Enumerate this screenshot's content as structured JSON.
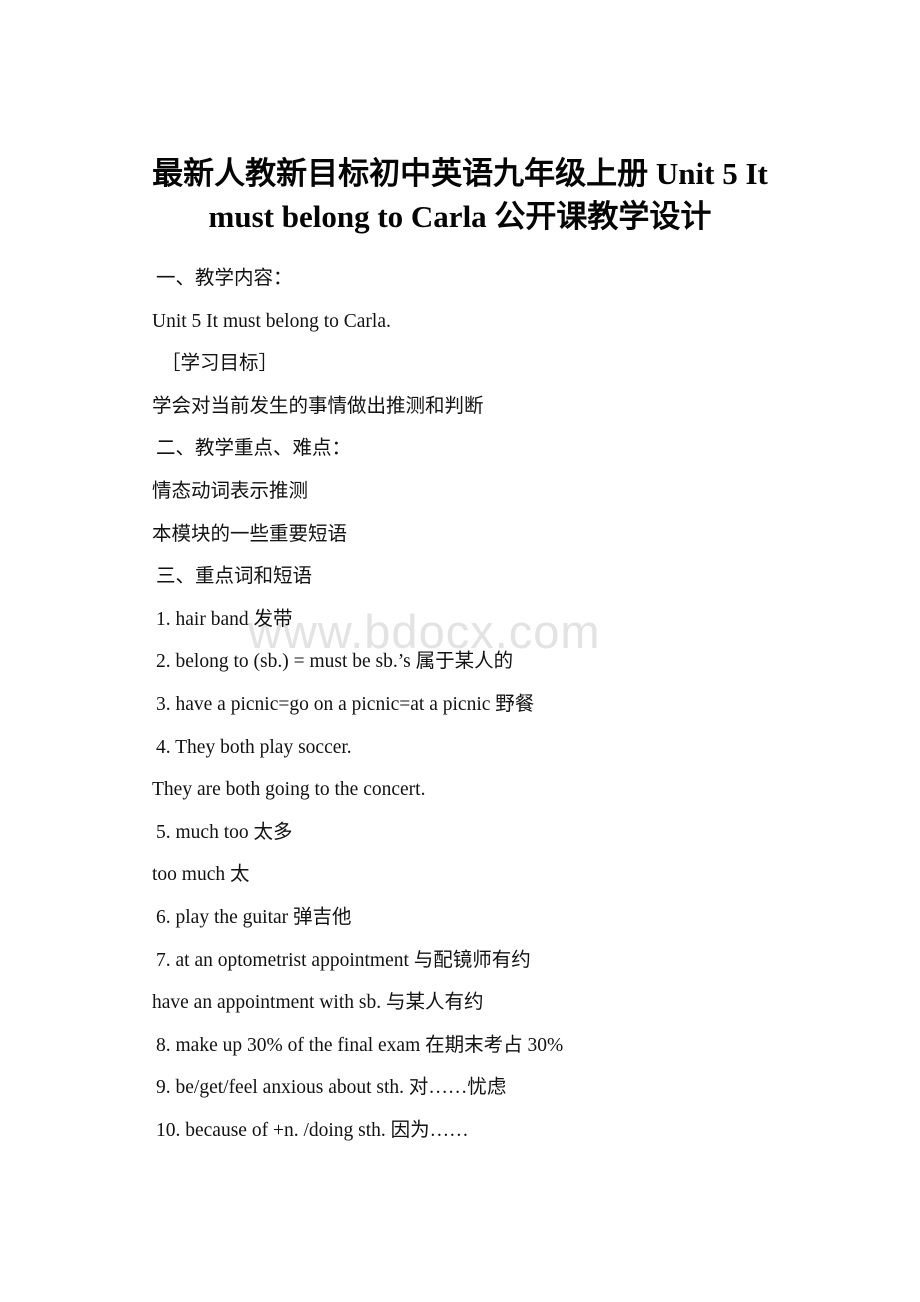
{
  "document": {
    "title_lines": [
      "最新人教新目标初中英语九年级上册 Unit 5 It",
      "must belong to Carla 公开课教学设计"
    ],
    "watermark": "www.bdocx.com",
    "watermark_color": "#e3e3e3",
    "text_color": "#121212",
    "background_color": "#ffffff",
    "lines": [
      {
        "id": "section-1-heading",
        "text": "一、教学内容：",
        "style": "indent-1"
      },
      {
        "id": "unit-reference",
        "text": "Unit 5 It must belong to Carla.",
        "style": "plain"
      },
      {
        "id": "objectives-heading",
        "text": "［学习目标］",
        "style": "indent-2"
      },
      {
        "id": "objectives-body",
        "text": "学会对当前发生的事情做出推测和判断",
        "style": "plain"
      },
      {
        "id": "section-2-heading",
        "text": "二、教学重点、难点：",
        "style": "indent-1"
      },
      {
        "id": "key-point-1",
        "text": "情态动词表示推测",
        "style": "plain"
      },
      {
        "id": "key-point-2",
        "text": "本模块的一些重要短语",
        "style": "plain"
      },
      {
        "id": "section-3-heading",
        "text": "三、重点词和短语",
        "style": "indent-1"
      },
      {
        "id": "vocab-1",
        "text": "1. hair band 发带",
        "style": "item"
      },
      {
        "id": "vocab-2",
        "text": "2. belong to (sb.) = must be sb.’s 属于某人的",
        "style": "item"
      },
      {
        "id": "vocab-3",
        "text": "3. have a picnic=go on a picnic=at a picnic 野餐",
        "style": "item"
      },
      {
        "id": "vocab-4",
        "text": "4. They both play soccer.",
        "style": "item"
      },
      {
        "id": "vocab-4b",
        "text": "They are both going to the concert.",
        "style": "plain"
      },
      {
        "id": "vocab-5",
        "text": "5. much too 太多",
        "style": "item"
      },
      {
        "id": "vocab-5b",
        "text": "too much 太",
        "style": "plain"
      },
      {
        "id": "vocab-6",
        "text": "6. play the guitar 弹吉他",
        "style": "item"
      },
      {
        "id": "vocab-7",
        "text": "7. at an optometrist appointment 与配镜师有约",
        "style": "item"
      },
      {
        "id": "vocab-7b",
        "text": "have an appointment with sb. 与某人有约",
        "style": "plain"
      },
      {
        "id": "vocab-8",
        "text": "8. make up 30% of the final exam 在期末考占 30%",
        "style": "item"
      },
      {
        "id": "vocab-9",
        "text": "9. be/get/feel anxious about sth. 对……忧虑",
        "style": "item"
      },
      {
        "id": "vocab-10",
        "text": "10. because of +n. /doing sth. 因为……",
        "style": "item"
      }
    ]
  }
}
